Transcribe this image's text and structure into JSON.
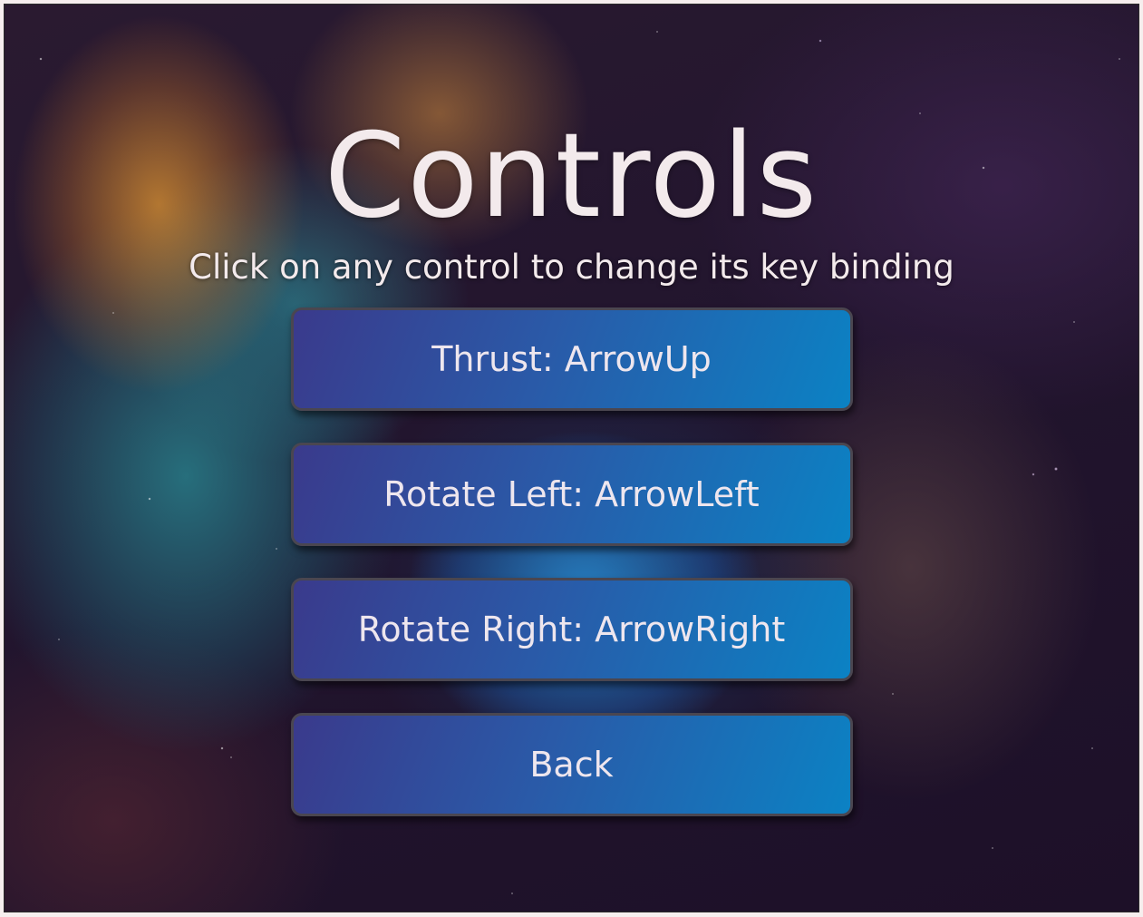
{
  "screen": {
    "title": "Controls",
    "subtitle": "Click on any control to change its key binding"
  },
  "controls": {
    "thrust_label": "Thrust: ArrowUp",
    "rotate_left_label": "Rotate Left: ArrowLeft",
    "rotate_right_label": "Rotate Right: ArrowRight"
  },
  "back_label": "Back",
  "colors": {
    "button_gradient_start": "#3a3a8c",
    "button_gradient_end": "#0b82c4",
    "text": "#f3eaec"
  }
}
